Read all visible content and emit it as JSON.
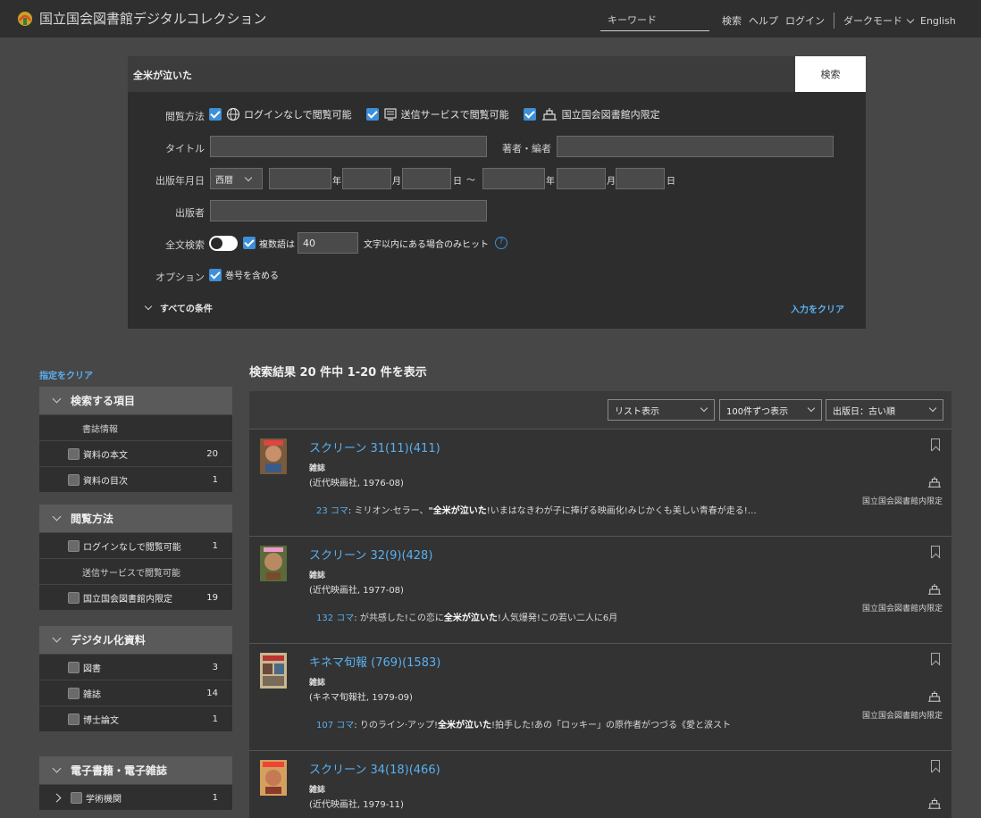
{
  "header": {
    "title": "国立国会図書館デジタルコレクション",
    "keyword_placeholder": "キーワード",
    "nav": [
      "検索",
      "ヘルプ",
      "ログイン"
    ],
    "dark_mode": "ダークモード",
    "lang": "English"
  },
  "search": {
    "query": "全米が泣いた",
    "button": "検索",
    "browse_label": "閲覧方法",
    "browse_options": [
      "ログインなしで閲覧可能",
      "送信サービスで閲覧可能",
      "国立国会図書館内限定"
    ],
    "title_label": "タイトル",
    "author_label": "著者・編者",
    "date_label": "出版年月日",
    "era": "西暦",
    "year": "年",
    "month": "月",
    "day": "日",
    "range": "〜",
    "publisher_label": "出版者",
    "fulltext_label": "全文検索",
    "multi_word": "複数語は",
    "distance": "40",
    "distance_suffix": "文字以内にある場合のみヒット",
    "help": "?",
    "option_label": "オプション",
    "option_text": "巻号を含める",
    "all_conditions": "すべての条件",
    "clear_input": "入力をクリア"
  },
  "sidebar": {
    "clear": "指定をクリア",
    "groups": [
      {
        "title": "検索する項目",
        "rows": [
          {
            "label": "書誌情報",
            "count": "",
            "checkbox": false
          },
          {
            "label": "資料の本文",
            "count": "20",
            "checkbox": true
          },
          {
            "label": "資料の目次",
            "count": "1",
            "checkbox": true
          }
        ]
      },
      {
        "title": "閲覧方法",
        "rows": [
          {
            "label": "ログインなしで閲覧可能",
            "count": "1",
            "checkbox": true
          },
          {
            "label": "送信サービスで閲覧可能",
            "count": "",
            "checkbox": false
          },
          {
            "label": "国立国会図書館内限定",
            "count": "19",
            "checkbox": true
          }
        ]
      },
      {
        "title": "デジタル化資料",
        "rows": [
          {
            "label": "図書",
            "count": "3",
            "checkbox": true
          },
          {
            "label": "雑誌",
            "count": "14",
            "checkbox": true
          },
          {
            "label": "博士論文",
            "count": "1",
            "checkbox": true
          }
        ]
      },
      {
        "title": "電子書籍・電子雑誌",
        "rows": [
          {
            "label": "学術機関",
            "count": "1",
            "checkbox": true
          }
        ]
      }
    ]
  },
  "results": {
    "summary": "検索結果 20 件中 1-20 件を表示",
    "view_mode": "リスト表示",
    "per_page": "100件ずつ表示",
    "sort": "出版日：古い順",
    "items": [
      {
        "title": "スクリーン 31(11)(411)",
        "type": "雑誌",
        "publisher": "(近代映画社, 1976-08)",
        "koma": "23 コマ",
        "snippet_pre": ": ミリオン·セラー、",
        "snippet_kw": "\"全米が泣いた",
        "snippet_post": "!いまはなきわが子に捧げる映画化!みじかくも美しい青春が走る!…",
        "access": "国立国会図書館内限定"
      },
      {
        "title": "スクリーン 32(9)(428)",
        "type": "雑誌",
        "publisher": "(近代映画社, 1977-08)",
        "koma": "132 コマ",
        "snippet_pre": ": が共感した!この恋に",
        "snippet_kw": "全米が泣いた",
        "snippet_post": "!人気爆発!この若い二人に6月",
        "access": "国立国会図書館内限定"
      },
      {
        "title": "キネマ旬報 (769)(1583)",
        "type": "雑誌",
        "publisher": "(キネマ旬報社, 1979-09)",
        "koma": "107 コマ",
        "snippet_pre": ": りのライン·アップ!",
        "snippet_kw": "全米が泣いた",
        "snippet_post": "!拍手した!あの「ロッキー」の原作者がつづる《愛と涙スト",
        "access": "国立国会図書館内限定"
      },
      {
        "title": "スクリーン 34(18)(466)",
        "type": "雑誌",
        "publisher": "(近代映画社, 1979-11)",
        "koma": "",
        "snippet_pre": "",
        "snippet_kw": "",
        "snippet_post": "",
        "access": ""
      }
    ]
  }
}
